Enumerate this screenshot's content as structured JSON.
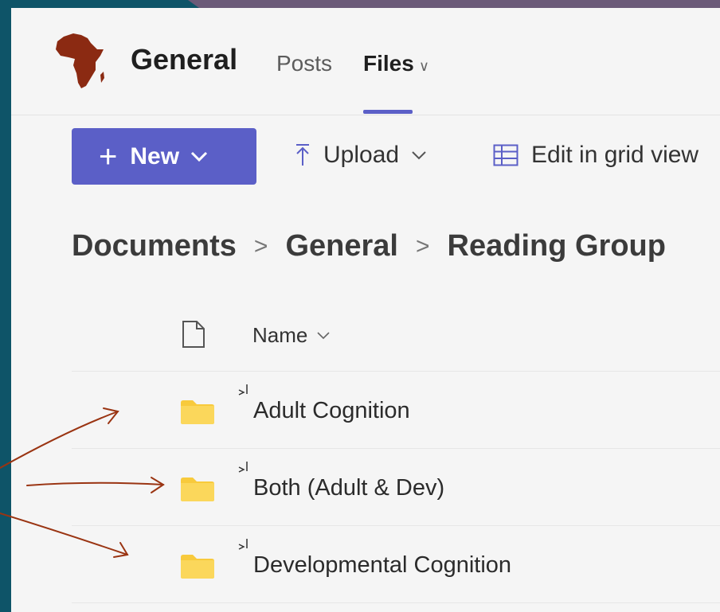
{
  "header": {
    "channel_title": "General",
    "tabs": [
      {
        "label": "Posts",
        "active": false
      },
      {
        "label": "Files",
        "active": true
      }
    ]
  },
  "toolbar": {
    "new_label": "New",
    "upload_label": "Upload",
    "grid_label": "Edit in grid view"
  },
  "breadcrumb": [
    "Documents",
    "General",
    "Reading Group"
  ],
  "list": {
    "name_column": "Name",
    "items": [
      {
        "name": "Adult Cognition",
        "type": "folder"
      },
      {
        "name": "Both (Adult & Dev)",
        "type": "folder"
      },
      {
        "name": "Developmental Cognition",
        "type": "folder"
      }
    ]
  },
  "colors": {
    "accent": "#5b5fc7",
    "folder": "#f8ca3c",
    "arrow": "#9a3412",
    "logo": "#8b2a12",
    "frame": "#0e5468"
  },
  "icons": [
    "africa-logo",
    "chevron-down-icon",
    "upload-icon",
    "grid-view-icon",
    "document-icon",
    "folder-icon",
    "new-item-icon"
  ]
}
